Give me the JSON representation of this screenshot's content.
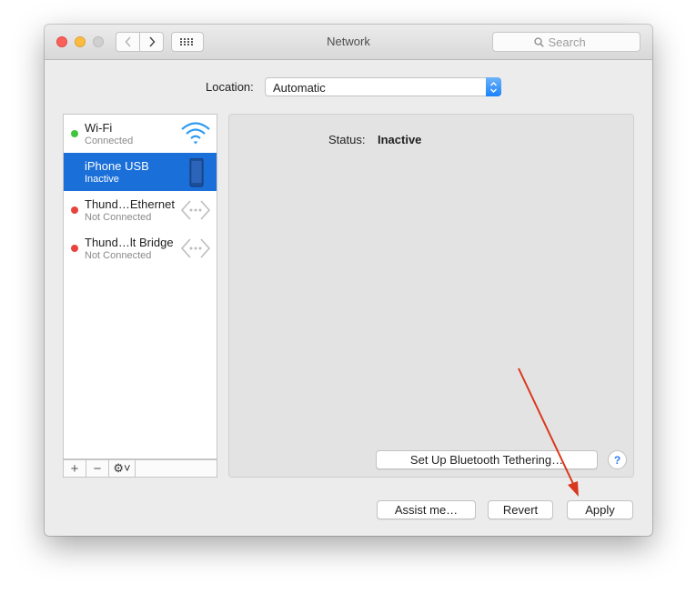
{
  "window": {
    "title": "Network"
  },
  "search": {
    "placeholder": "Search"
  },
  "location": {
    "label": "Location:",
    "value": "Automatic"
  },
  "services": [
    {
      "name": "Wi-Fi",
      "status": "Connected",
      "dot_color": "#3ec53a",
      "icon": "wifi-icon"
    },
    {
      "name": "iPhone USB",
      "status": "Inactive",
      "dot_color": "",
      "icon": "iphone-icon"
    },
    {
      "name": "Thund…Ethernet",
      "status": "Not Connected",
      "dot_color": "#e8433c",
      "icon": "ethernet-icon"
    },
    {
      "name": "Thund…lt Bridge",
      "status": "Not Connected",
      "dot_color": "#e8433c",
      "icon": "bridge-icon"
    }
  ],
  "list_toolbar": {
    "add_label": "+",
    "remove_label": "−",
    "gear_label": "⚙︎˅"
  },
  "detail": {
    "status_label": "Status:",
    "status_value": "Inactive",
    "tethering_button": "Set Up Bluetooth Tethering…",
    "help_label": "?"
  },
  "footer": {
    "assist_label": "Assist me…",
    "revert_label": "Revert",
    "apply_label": "Apply"
  },
  "colors": {
    "selection": "#1a6fd9",
    "accent": "#2a7ef5",
    "annotation_arrow": "#d9381e"
  }
}
